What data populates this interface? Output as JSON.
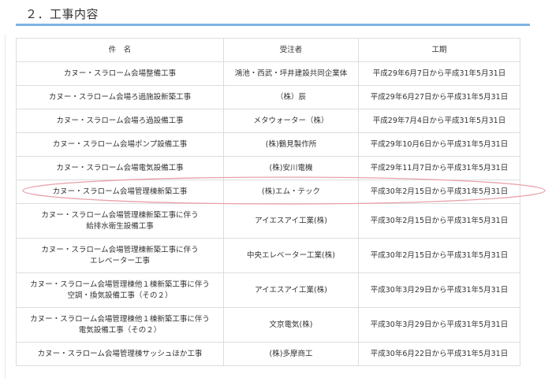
{
  "section": {
    "title": "２．工事内容"
  },
  "table": {
    "headers": {
      "name": "件　名",
      "contractor": "受注者",
      "period": "工期"
    },
    "rows": [
      {
        "name": "カヌー・スラローム会場整備工事",
        "contractor": "鴻池・西武・坪井建設共同企業体",
        "period": "平成29年6月7日から平成31年5月31日"
      },
      {
        "name": "カヌー・スラローム会場ろ過施設新築工事",
        "contractor": "（株）辰",
        "period": "平成29年6月27日から平成31年5月31日"
      },
      {
        "name": "カヌー・スラローム会場ろ過設備工事",
        "contractor": "メタウォーター（株）",
        "period": "平成29年7月4日から平成31年5月31日"
      },
      {
        "name": "カヌー・スラローム会場ポンプ設備工事",
        "contractor": "(株)鶴見製作所",
        "period": "平成29年10月6日から平成31年5月31日"
      },
      {
        "name": "カヌー・スラローム会場電気設備工事",
        "contractor": "(株)安川電機",
        "period": "平成29年11月7日から平成31年5月31日"
      },
      {
        "name": "カヌー・スラローム会場管理棟新築工事",
        "contractor": "(株)エム・テック",
        "period": "平成30年2月15日から平成31年5月31日"
      },
      {
        "name": "カヌー・スラローム会場管理棟新築工事に伴う\n給排水衛生設備工事",
        "contractor": "アイエスアイ工業(株)",
        "period": "平成30年2月15日から平成31年5月31日"
      },
      {
        "name": "カヌー・スラローム会場管理棟新築工事に伴う\nエレベーター工事",
        "contractor": "中央エレベーター工業(株)",
        "period": "平成30年2月15日から平成31年5月31日"
      },
      {
        "name": "カヌー・スラローム会場管理棟他１棟新築工事に伴う\n空調・換気設備工事（その２）",
        "contractor": "アイエスアイ工業(株)",
        "period": "平成30年3月29日から平成31年5月31日"
      },
      {
        "name": "カヌー・スラローム会場管理棟他１棟新築工事に伴う\n電気設備工事（その２）",
        "contractor": "文京電気(株)",
        "period": "平成30年3月29日から平成31年5月31日"
      },
      {
        "name": "カヌー・スラローム会場管理棟サッシュほか工事",
        "contractor": "(株)多摩商工",
        "period": "平成30年6月22日から平成31年5月31日"
      }
    ]
  },
  "highlight": {
    "color": "#e8a0a8",
    "row_index": 5
  },
  "colors": {
    "title_rule": "#7fb2e5",
    "border": "#dddddd"
  }
}
